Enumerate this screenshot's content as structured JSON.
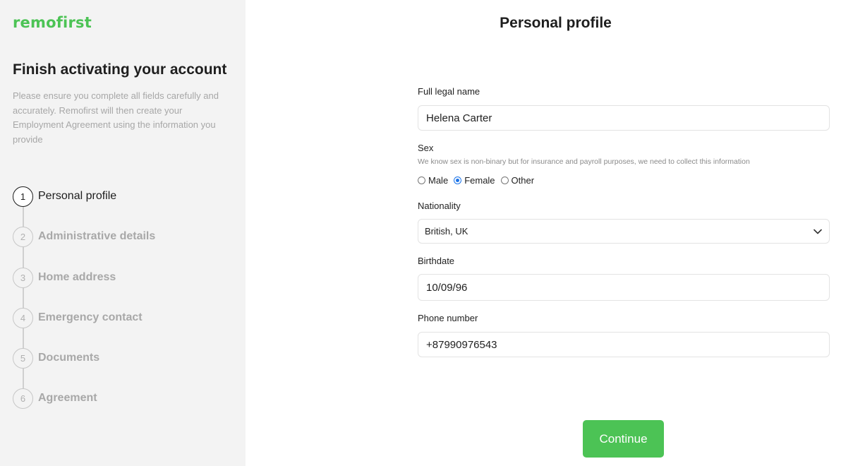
{
  "brand": {
    "logo_text": "remofirst",
    "accent": "#4cc355"
  },
  "sidebar": {
    "title": "Finish activating your account",
    "description": "Please ensure you complete all fields carefully and accurately. Remofirst will then create your Employment Agreement using the information you provide",
    "steps": [
      {
        "num": "1",
        "label": "Personal profile",
        "active": true
      },
      {
        "num": "2",
        "label": "Administrative details",
        "active": false
      },
      {
        "num": "3",
        "label": "Home address",
        "active": false
      },
      {
        "num": "4",
        "label": "Emergency contact",
        "active": false
      },
      {
        "num": "5",
        "label": "Documents",
        "active": false
      },
      {
        "num": "6",
        "label": "Agreement",
        "active": false
      }
    ]
  },
  "main": {
    "title": "Personal profile",
    "form": {
      "full_name": {
        "label": "Full legal name",
        "value": "Helena Carter"
      },
      "sex": {
        "label": "Sex",
        "hint": "We know sex is non-binary but for insurance and payroll purposes, we need to collect this information",
        "options": [
          "Male",
          "Female",
          "Other"
        ],
        "selected": "Female"
      },
      "nationality": {
        "label": "Nationality",
        "value": "British, UK",
        "icon": "chevron-down-icon"
      },
      "birthdate": {
        "label": "Birthdate",
        "value": "10/09/96"
      },
      "phone": {
        "label": "Phone number",
        "value": "+87990976543"
      }
    },
    "continue_label": "Continue"
  }
}
